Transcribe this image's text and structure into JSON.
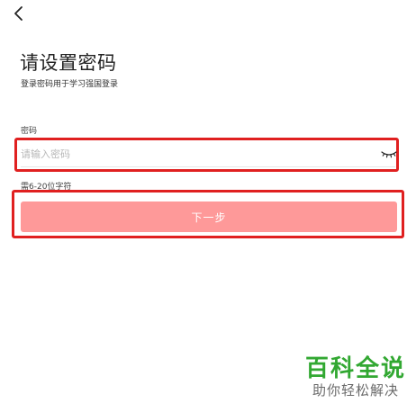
{
  "header": {
    "back_icon": "chevron-left-icon"
  },
  "main": {
    "title": "请设置密码",
    "subtitle": "登录密码用于学习强国登录",
    "password_label": "密码",
    "password_value": "",
    "password_placeholder": "请输入密码",
    "visibility_icon": "eye-closed-icon",
    "hint": "需6-20位字符",
    "next_button_label": "下一步"
  },
  "colors": {
    "button_background": "#fe9999",
    "highlight_border": "#e02020",
    "watermark_green": "#32a832"
  },
  "watermark": {
    "main": "百科全说",
    "sub": "助你轻松解决"
  }
}
